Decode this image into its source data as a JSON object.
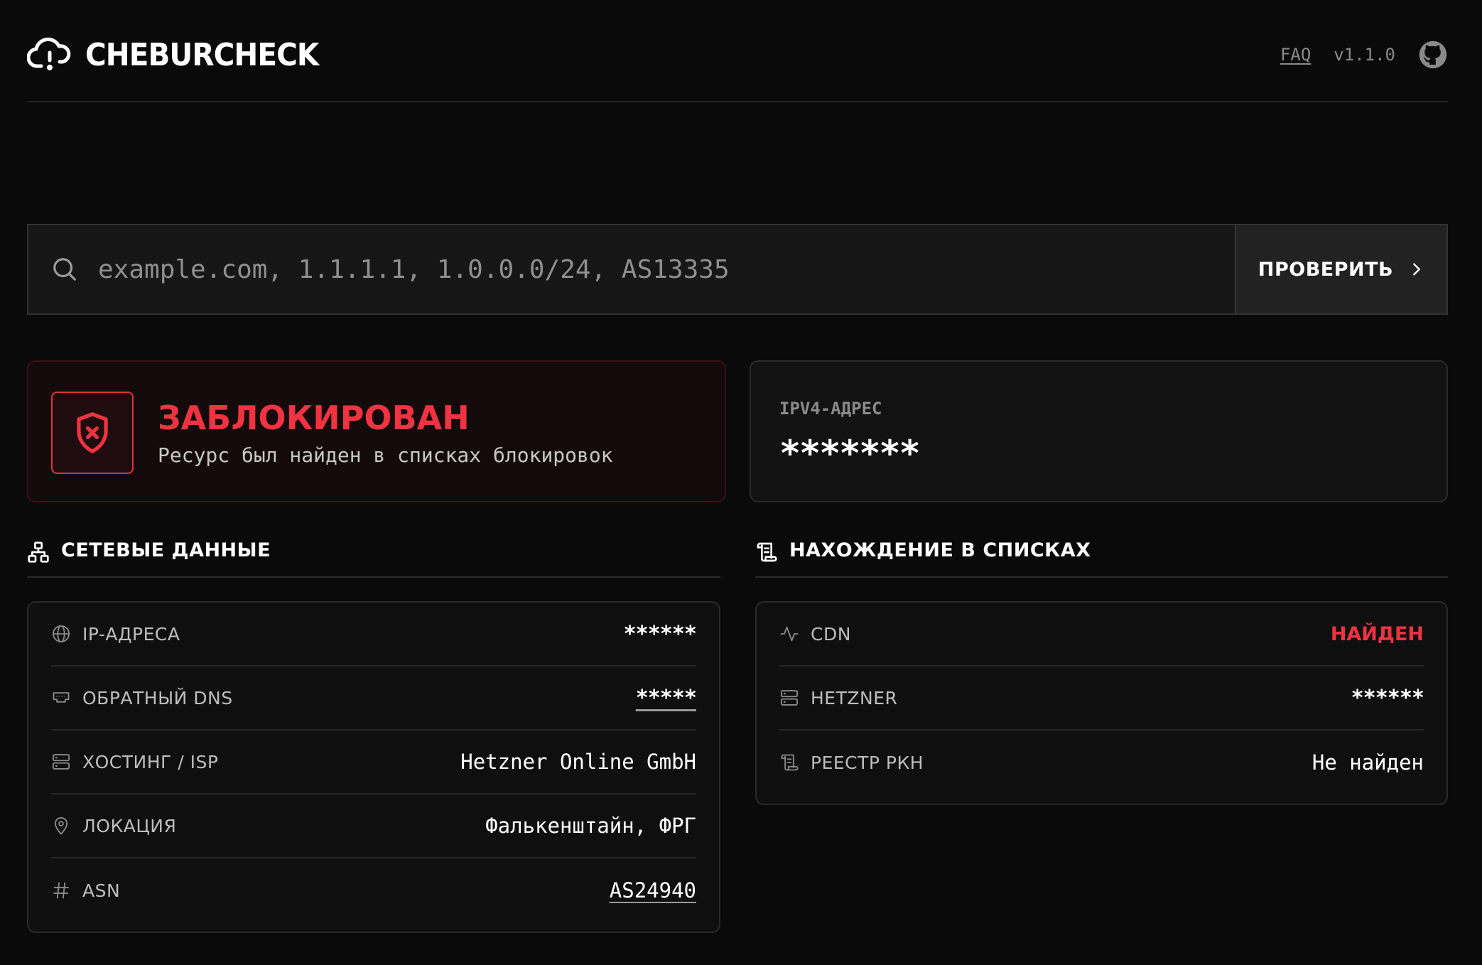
{
  "header": {
    "brand": "CHEBURCHECK",
    "faq": "FAQ",
    "version": "v1.1.0"
  },
  "search": {
    "placeholder": "example.com, 1.1.1.1, 1.0.0.0/24, AS13335",
    "button_label": "ПРОВЕРИТЬ"
  },
  "status": {
    "title": "ЗАБЛОКИРОВАН",
    "subtitle": "Ресурс был найден в списках блокировок"
  },
  "ipv4": {
    "label": "IPV4-АДРЕС",
    "value": "*******"
  },
  "network": {
    "title": "СЕТЕВЫЕ ДАННЫЕ",
    "rows": [
      {
        "label": "IP-АДРЕСА",
        "value": "******"
      },
      {
        "label": "ОБРАТНЫЙ DNS",
        "value": "*****"
      },
      {
        "label": "ХОСТИНГ / ISP",
        "value": "Hetzner Online GmbH"
      },
      {
        "label": "ЛОКАЦИЯ",
        "value": "Фалькенштайн, ФРГ"
      },
      {
        "label": "ASN",
        "value": "AS24940"
      }
    ]
  },
  "lists": {
    "title": "НАХОЖДЕНИЕ В СПИСКАХ",
    "rows": [
      {
        "label": "CDN",
        "value": "НАЙДЕН"
      },
      {
        "label": "HETZNER",
        "value": "******"
      },
      {
        "label": "РЕЕСТР РКН",
        "value": "Не найден"
      }
    ]
  },
  "colors": {
    "background": "#0a0a0a",
    "accent_red": "#ef3340",
    "muted_text": "#8a8a8a"
  }
}
